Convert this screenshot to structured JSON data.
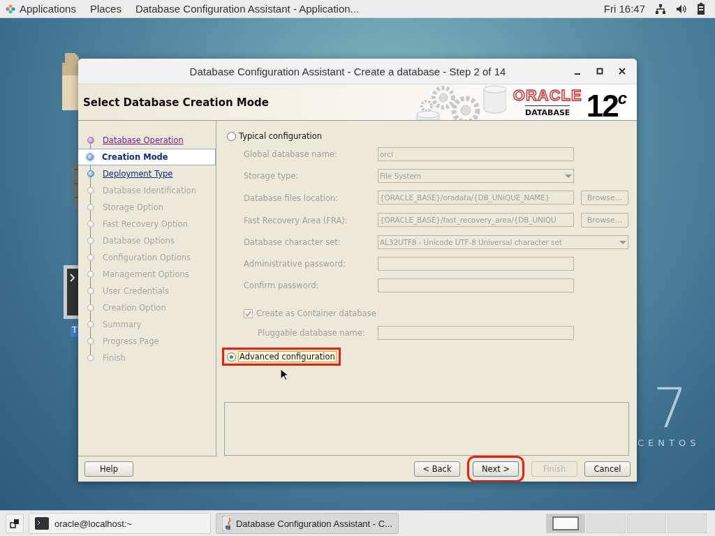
{
  "top_bar": {
    "menus": [
      "Applications",
      "Places"
    ],
    "active_window": "Database Configuration Assistant - Application...",
    "clock": "Fri 16:47"
  },
  "desktop": {
    "icons": [
      {
        "kind": "folder"
      },
      {
        "kind": "trash"
      },
      {
        "kind": "terminal",
        "label": "T"
      }
    ],
    "wallpaper": {
      "number": "7",
      "brand": "CENTOS"
    }
  },
  "dialog": {
    "title": "Database Configuration Assistant - Create a database - Step 2 of 14",
    "header": "Select Database Creation Mode",
    "logo": {
      "brand": "ORACLE",
      "product": "DATABASE",
      "version": "12$^{c}$"
    },
    "steps": [
      {
        "label": "Database Operation",
        "kind": "visited",
        "selected": false
      },
      {
        "label": "Creation Mode",
        "kind": "link",
        "selected": true
      },
      {
        "label": "Deployment Type",
        "kind": "link",
        "selected": false
      },
      {
        "label": "Database Identification",
        "kind": "pending",
        "selected": false
      },
      {
        "label": "Storage Option",
        "kind": "pending",
        "selected": false
      },
      {
        "label": "Fast Recovery Option",
        "kind": "pending",
        "selected": false
      },
      {
        "label": "Database Options",
        "kind": "pending",
        "selected": false
      },
      {
        "label": "Configuration Options",
        "kind": "pending",
        "selected": false
      },
      {
        "label": "Management Options",
        "kind": "pending",
        "selected": false
      },
      {
        "label": "User Credentials",
        "kind": "pending",
        "selected": false
      },
      {
        "label": "Creation Option",
        "kind": "pending",
        "selected": false
      },
      {
        "label": "Summary",
        "kind": "pending",
        "selected": false
      },
      {
        "label": "Progress Page",
        "kind": "pending",
        "selected": false
      },
      {
        "label": "Finish",
        "kind": "pending",
        "selected": false
      }
    ],
    "typical_option": {
      "label": "Typical configuration",
      "selected": false,
      "highlighted": false
    },
    "fields": [
      {
        "label": "Global database name:",
        "kind": "text",
        "value": "orcl",
        "disabled": true
      },
      {
        "label": "Storage type:",
        "kind": "dropdown",
        "value": "File System",
        "disabled": true
      },
      {
        "label": "Database files location:",
        "kind": "text",
        "value": "{ORACLE_BASE}/oradata/{DB_UNIQUE_NAME}",
        "browse": "Browse...",
        "disabled": true
      },
      {
        "label": "Fast Recovery Area (FRA):",
        "kind": "text",
        "value": "{ORACLE_BASE}/fast_recovery_area/{DB_UNIQU",
        "browse": "Browse...",
        "disabled": true
      },
      {
        "label": "Database character set:",
        "kind": "wide_dropdown",
        "value": "AL32UTF8 - Unicode UTF-8 Universal character set",
        "disabled": true
      },
      {
        "label": "Administrative password:",
        "kind": "text",
        "disabled": true
      },
      {
        "label": "Confirm password:",
        "kind": "text",
        "disabled": true
      }
    ],
    "container": {
      "label": "Create as Container database",
      "checked": true,
      "disabled": true
    },
    "pluggable": {
      "label": "Pluggable database name:",
      "disabled": true
    },
    "advanced_option": {
      "label": "Advanced configuration",
      "selected": true,
      "highlighted": true
    },
    "buttons": [
      {
        "label": "Help",
        "kind": "left",
        "disabled": false,
        "highlighted": false
      },
      {
        "label": "< Back",
        "kind": "right",
        "disabled": false,
        "highlighted": false
      },
      {
        "label": "Next >",
        "kind": "right",
        "disabled": false,
        "highlighted": true
      },
      {
        "label": "Finish",
        "kind": "right",
        "disabled": true,
        "highlighted": false
      },
      {
        "label": "Cancel",
        "kind": "right",
        "disabled": false,
        "highlighted": false
      }
    ]
  },
  "taskbar": {
    "items": [
      {
        "label": "oracle@localhost:~",
        "kind": "terminal",
        "selected": false
      },
      {
        "label": "Database Configuration Assistant - C...",
        "kind": "java",
        "selected": true
      }
    ],
    "workspaces": [
      {
        "selected": true
      },
      {
        "selected": false
      },
      {
        "selected": false
      },
      {
        "selected": false
      }
    ]
  }
}
